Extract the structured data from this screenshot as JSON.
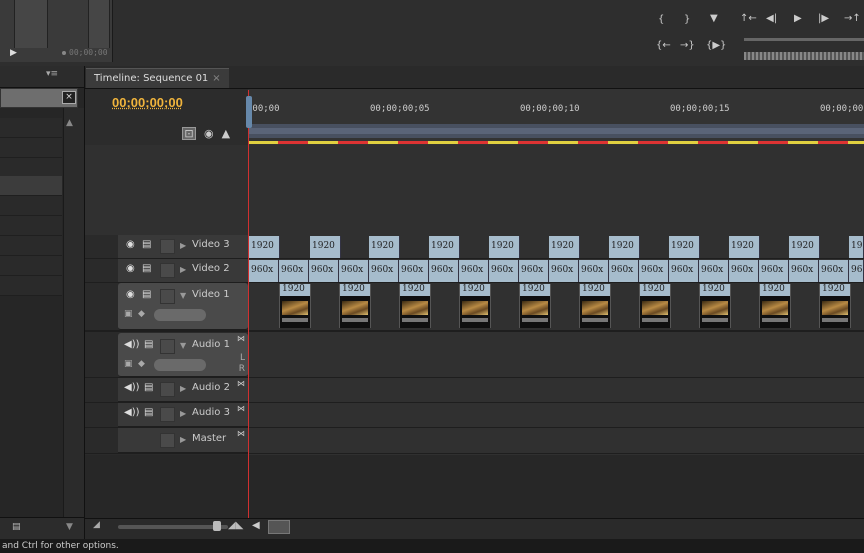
{
  "timeline": {
    "tab_title": "Timeline: Sequence 01",
    "tab_close": "×",
    "timecode": "00;00;00;00",
    "ruler_labels": [
      ";00;00",
      "00;00;00;05",
      "00;00;00;10",
      "00;00;00;15",
      "00;00;00"
    ],
    "tracks": [
      {
        "name": "Video 3",
        "expanded": false,
        "kind": "video"
      },
      {
        "name": "Video 2",
        "expanded": false,
        "kind": "video"
      },
      {
        "name": "Video 1",
        "expanded": true,
        "kind": "video"
      },
      {
        "name": "Audio 1",
        "expanded": true,
        "kind": "audio",
        "sub_l": "L",
        "sub_r": "R"
      },
      {
        "name": "Audio 2",
        "expanded": false,
        "kind": "audio"
      },
      {
        "name": "Audio 3",
        "expanded": false,
        "kind": "audio"
      },
      {
        "name": "Master",
        "expanded": false,
        "kind": "master"
      }
    ],
    "v3_clip_label": "1920",
    "v2_clip_label": "960x",
    "v1_clip_label": "1920",
    "v3_last_label": "19",
    "v2_last_label": "96"
  },
  "top": {
    "mini_timecode": "00;00;00"
  },
  "icons": {
    "eye": "eye-icon",
    "film": "film-icon",
    "speaker": "speaker-icon",
    "close": "close-icon"
  },
  "status": {
    "text": "and Ctrl for other options."
  },
  "colors": {
    "timecode": "#f0b43c",
    "clip": "#a6bccc",
    "playhead": "#d03030"
  }
}
